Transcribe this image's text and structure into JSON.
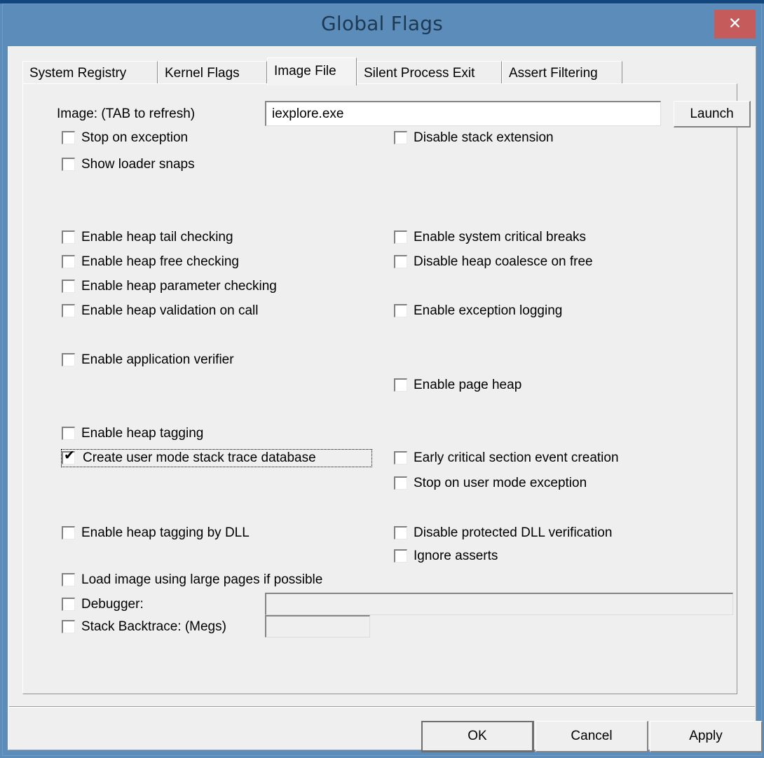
{
  "window": {
    "title": "Global Flags",
    "close_label": "✕",
    "frame_color": "#5b8cba",
    "close_color": "#c65b5b",
    "face_color": "#efefef"
  },
  "tabs": [
    {
      "label": "System Registry",
      "selected": false
    },
    {
      "label": "Kernel Flags",
      "selected": false
    },
    {
      "label": "Image File",
      "selected": true
    },
    {
      "label": "Silent Process Exit",
      "selected": false
    },
    {
      "label": "Assert Filtering",
      "selected": false
    }
  ],
  "image_row": {
    "label": "Image: (TAB to refresh)",
    "value": "iexplore.exe",
    "placeholder": "",
    "launch_label": "Launch"
  },
  "checkboxes": [
    {
      "label": "Stop on exception",
      "checked": false,
      "focused": false
    },
    {
      "label": "Show loader snaps",
      "checked": false,
      "focused": false
    },
    {
      "label": "Disable stack extension",
      "checked": false,
      "focused": false
    },
    {
      "label": "Enable heap tail checking",
      "checked": false,
      "focused": false
    },
    {
      "label": "Enable heap free checking",
      "checked": false,
      "focused": false
    },
    {
      "label": "Enable heap parameter checking",
      "checked": false,
      "focused": false
    },
    {
      "label": "Enable heap validation on call",
      "checked": false,
      "focused": false
    },
    {
      "label": "Enable system critical breaks",
      "checked": false,
      "focused": false
    },
    {
      "label": "Disable heap coalesce on free",
      "checked": false,
      "focused": false
    },
    {
      "label": "Enable exception logging",
      "checked": false,
      "focused": false
    },
    {
      "label": "Enable application verifier",
      "checked": false,
      "focused": false
    },
    {
      "label": "Enable page heap",
      "checked": false,
      "focused": false
    },
    {
      "label": "Enable heap tagging",
      "checked": false,
      "focused": false
    },
    {
      "label": "Create user mode stack trace database",
      "checked": true,
      "focused": true
    },
    {
      "label": "Early critical section event creation",
      "checked": false,
      "focused": false
    },
    {
      "label": "Stop on user mode exception",
      "checked": false,
      "focused": false
    },
    {
      "label": "Enable heap tagging by DLL",
      "checked": false,
      "focused": false
    },
    {
      "label": "Disable protected DLL verification",
      "checked": false,
      "focused": false
    },
    {
      "label": "Ignore asserts",
      "checked": false,
      "focused": false
    },
    {
      "label": "Load image using large pages if possible",
      "checked": false,
      "focused": false
    },
    {
      "label": "Debugger:",
      "checked": false,
      "focused": false
    },
    {
      "label": "Stack Backtrace: (Megs)",
      "checked": false,
      "focused": false
    }
  ],
  "check_glyph": "✔",
  "debugger_field": {
    "value": "",
    "placeholder": ""
  },
  "stack_backtrace_field": {
    "value": "",
    "placeholder": ""
  },
  "buttons": {
    "ok": "OK",
    "cancel": "Cancel",
    "apply": "Apply"
  }
}
